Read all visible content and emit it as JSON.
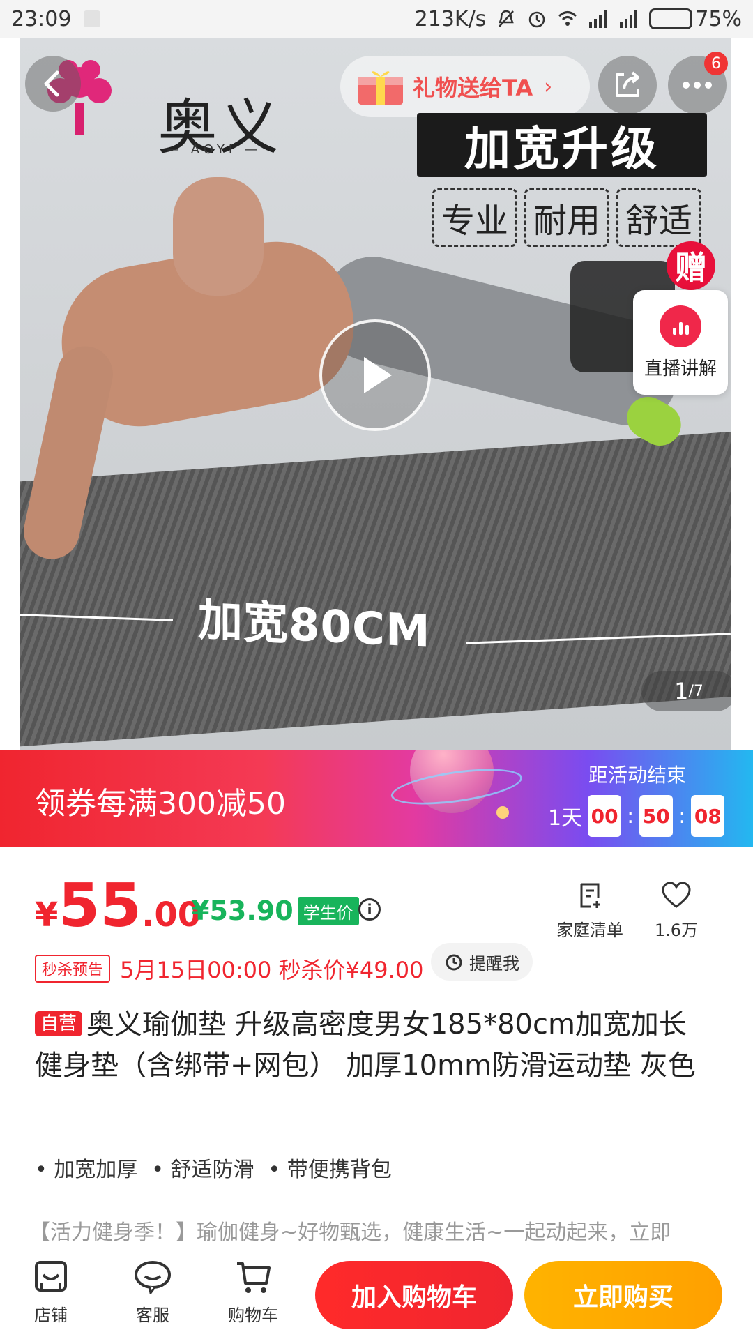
{
  "status_bar": {
    "time": "23:09",
    "net_speed": "213K/s",
    "battery": "75%",
    "battery_level": 0.75
  },
  "hero": {
    "brand_name": "奥义",
    "brand_sub": "— AOYI —",
    "gift_label": "礼物送给TA",
    "gift_arrow": "›",
    "more_badge": "6",
    "promo_banner": "加宽升级",
    "features": [
      "专业",
      "耐用",
      "舒适"
    ],
    "gift_chip": "赠",
    "live_label": "直播讲解",
    "wide_text": "加宽80CM",
    "page_current": "1",
    "page_total": "/7"
  },
  "coupon": {
    "text": "领券每满300减50",
    "countdown_label": "距活动结束",
    "days": "1天",
    "hours": "00",
    "minutes": "50",
    "seconds": "08",
    "sep": ":"
  },
  "price": {
    "currency": "¥",
    "integer": "55",
    "decimal": ".00",
    "student_price": "¥53.90",
    "student_tag": "学生价"
  },
  "side_actions": {
    "family_list": "家庭清单",
    "favorites_count": "1.6万"
  },
  "flash_sale": {
    "tag": "秒杀预告",
    "text": "5月15日00:00 秒杀价¥49.00",
    "remind_label": "提醒我"
  },
  "product": {
    "self_tag": "自营",
    "title": "奥义瑜伽垫 升级高密度男女185*80cm加宽加长健身垫（含绑带+网包） 加厚10mm防滑运动垫 灰色",
    "bullets": [
      "• 加宽加厚",
      "• 舒适防滑",
      "• 带便携背包"
    ],
    "promo_line": "【活力健身季！】瑜伽健身~好物甄选，健康生活~一起动起来，立即"
  },
  "bottom_bar": {
    "shop": "店铺",
    "service": "客服",
    "cart": "购物车",
    "add_to_cart": "加入购物车",
    "buy_now": "立即购买"
  },
  "colors": {
    "accent_red": "#f0252f",
    "student_green": "#18b45b",
    "buy_orange": "#ffac00"
  }
}
